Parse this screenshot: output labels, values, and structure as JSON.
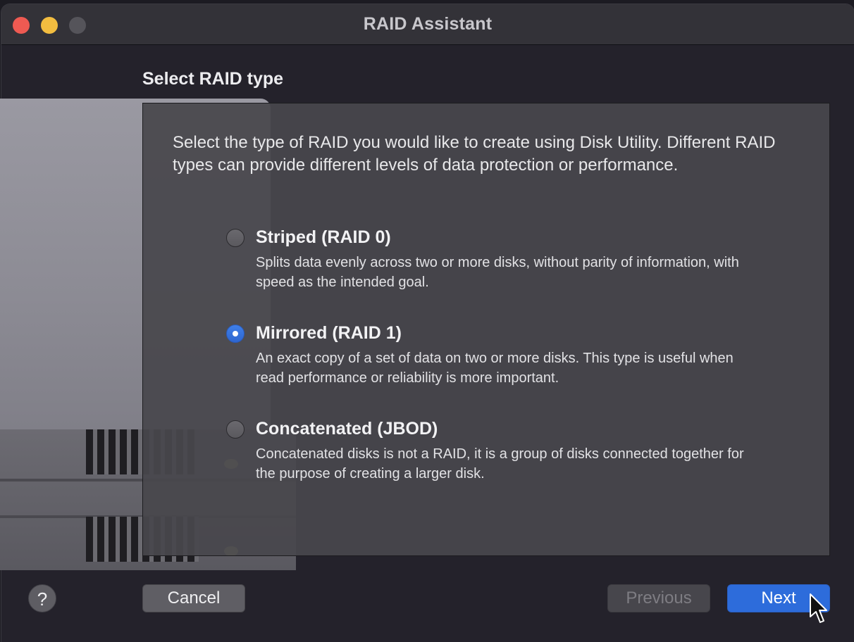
{
  "window": {
    "title": "RAID Assistant",
    "traffic_lights": {
      "close": "#ee5a52",
      "minimize": "#f2bd40",
      "maximize": "#55545a"
    }
  },
  "heading": "Select RAID type",
  "intro": "Select the type of RAID you would like to create using Disk Utility. Different RAID types can provide different levels of data protection or performance.",
  "options": [
    {
      "title": "Striped (RAID 0)",
      "description": "Splits data evenly across two or more disks, without parity of information, with speed as the intended goal.",
      "selected": false
    },
    {
      "title": "Mirrored (RAID 1)",
      "description": "An exact copy of a set of data on two or more disks. This type is useful when read performance or reliability is more important.",
      "selected": true
    },
    {
      "title": "Concatenated (JBOD)",
      "description": "Concatenated disks is not a RAID, it is a group of disks connected together for the purpose of creating a larger disk.",
      "selected": false
    }
  ],
  "buttons": {
    "help": "?",
    "cancel": "Cancel",
    "previous": "Previous",
    "next": "Next"
  },
  "colors": {
    "accent": "#2d6cdb",
    "panel": "#48474c"
  }
}
